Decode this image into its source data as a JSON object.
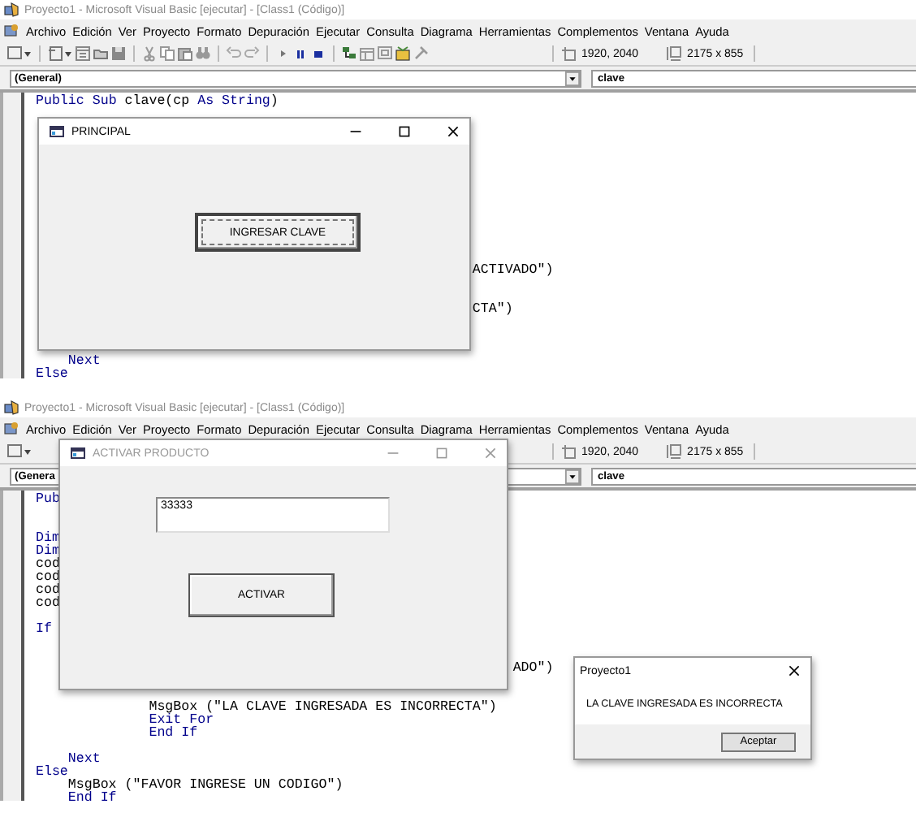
{
  "panels": [
    {
      "title": "Proyecto1 - Microsoft Visual Basic [ejecutar] - [Class1 (Código)]",
      "menu": [
        "Archivo",
        "Edición",
        "Ver",
        "Proyecto",
        "Formato",
        "Depuración",
        "Ejecutar",
        "Consulta",
        "Diagrama",
        "Herramientas",
        "Complementos",
        "Ventana",
        "Ayuda"
      ],
      "position": "1920, 2040",
      "size": "2175 x 855",
      "object_box": "(General)",
      "procedure_box": "clave",
      "code_lines": [
        {
          "tokens": [
            {
              "text": "Public ",
              "kind": "keyword"
            },
            {
              "text": "Sub ",
              "kind": "keyword"
            },
            {
              "text": "clave(cp ",
              "kind": "plain"
            },
            {
              "text": "As ",
              "kind": "keyword"
            },
            {
              "text": "String",
              "kind": "keyword"
            },
            {
              "text": ")",
              "kind": "plain"
            }
          ]
        },
        {
          "tokens": [
            {
              "text": "ACTIVADO\")",
              "kind": "plain"
            }
          ]
        },
        {
          "tokens": [
            {
              "text": "CTA\")",
              "kind": "plain"
            }
          ]
        },
        {
          "tokens": [
            {
              "text": "Next",
              "kind": "keyword"
            }
          ]
        },
        {
          "tokens": [
            {
              "text": "Else",
              "kind": "keyword"
            }
          ]
        }
      ],
      "dialogs": [
        {
          "kind": "form",
          "title": "PRINCIPAL",
          "active": true,
          "controls": [
            {
              "kind": "button",
              "label": "INGRESAR CLAVE",
              "focused": true
            }
          ]
        }
      ]
    },
    {
      "title": "Proyecto1 - Microsoft Visual Basic [ejecutar] - [Class1 (Código)]",
      "menu": [
        "Archivo",
        "Edición",
        "Ver",
        "Proyecto",
        "Formato",
        "Depuración",
        "Ejecutar",
        "Consulta",
        "Diagrama",
        "Herramientas",
        "Complementos",
        "Ventana",
        "Ayuda"
      ],
      "position": "1920, 2040",
      "size": "2175 x 855",
      "object_box": "(Genera",
      "procedure_box": "clave",
      "code_lines": [
        {
          "tokens": [
            {
              "text": "Pub",
              "kind": "keyword"
            }
          ]
        },
        {
          "tokens": [
            {
              "text": "Dim",
              "kind": "keyword"
            }
          ]
        },
        {
          "tokens": [
            {
              "text": "Dim",
              "kind": "keyword"
            }
          ]
        },
        {
          "tokens": [
            {
              "text": "cod",
              "kind": "plain"
            }
          ]
        },
        {
          "tokens": [
            {
              "text": "cod",
              "kind": "plain"
            }
          ]
        },
        {
          "tokens": [
            {
              "text": "cod",
              "kind": "plain"
            }
          ]
        },
        {
          "tokens": [
            {
              "text": "cod",
              "kind": "plain"
            }
          ]
        },
        {
          "tokens": [
            {
              "text": "If",
              "kind": "keyword"
            }
          ]
        },
        {
          "tokens": [
            {
              "text": "ADO\")",
              "kind": "plain"
            }
          ]
        },
        {
          "tokens": [
            {
              "text": "MsgBox (\"LA CLAVE INGRESADA ES INCORRECTA\")",
              "kind": "plain"
            }
          ]
        },
        {
          "tokens": [
            {
              "text": "Exit For",
              "kind": "keyword"
            }
          ]
        },
        {
          "tokens": [
            {
              "text": "End If",
              "kind": "keyword"
            }
          ]
        },
        {
          "tokens": [
            {
              "text": "Next",
              "kind": "keyword"
            }
          ]
        },
        {
          "tokens": [
            {
              "text": "Else",
              "kind": "keyword"
            }
          ]
        },
        {
          "tokens": [
            {
              "text": "MsgBox (\"FAVOR INGRESE UN CODIGO\")",
              "kind": "plain"
            }
          ]
        },
        {
          "tokens": [
            {
              "text": "End If",
              "kind": "keyword"
            }
          ]
        }
      ],
      "dialogs": [
        {
          "kind": "form",
          "title": "ACTIVAR PRODUCTO",
          "active": false,
          "controls": [
            {
              "kind": "textbox",
              "value": "33333"
            },
            {
              "kind": "button",
              "label": "ACTIVAR",
              "focused": false
            }
          ]
        },
        {
          "kind": "msgbox",
          "title": "Proyecto1",
          "message": "LA CLAVE INGRESADA ES INCORRECTA",
          "button": "Aceptar"
        }
      ]
    }
  ]
}
